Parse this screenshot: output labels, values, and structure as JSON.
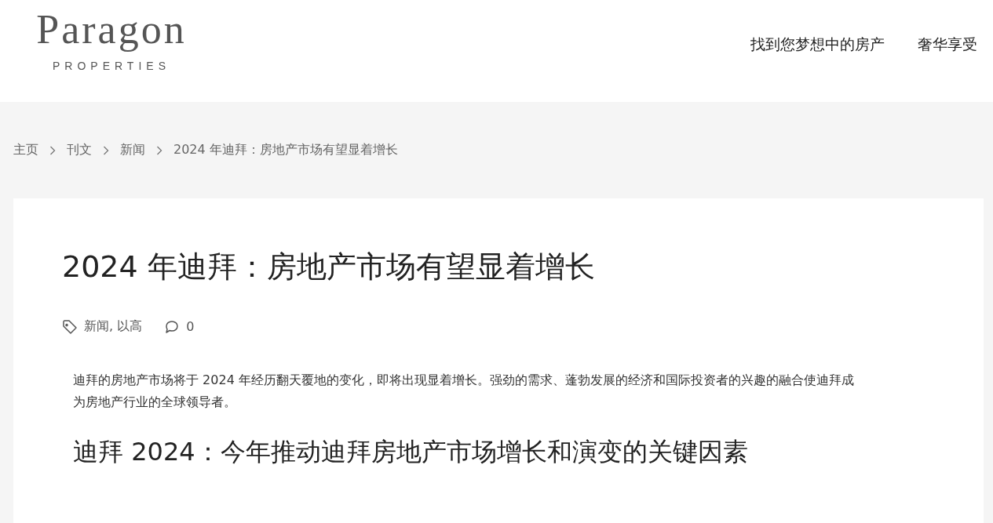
{
  "header": {
    "logo": {
      "name": "Paragon",
      "tagline": "PROPERTIES"
    },
    "nav": [
      {
        "label": "找到您梦想中的房产"
      },
      {
        "label": "奢华享受"
      }
    ]
  },
  "breadcrumb": [
    "主页",
    "刊文",
    "新闻",
    "2024 年迪拜：房地产市场有望显着增长"
  ],
  "article": {
    "title": "2024 年迪拜：房地产市场有望显着增长",
    "tags": "新闻, 以高",
    "comments": "0",
    "intro": "迪拜的房地产市场将于 2024 年经历翻天覆地的变化，即将出现显着增长。强劲的需求、蓬勃发展的经济和国际投资者的兴趣的融合使迪拜成为房地产行业的全球领导者。",
    "heading": "迪拜 2024：今年推动迪拜房地产市场增长和演变的关键因素"
  }
}
